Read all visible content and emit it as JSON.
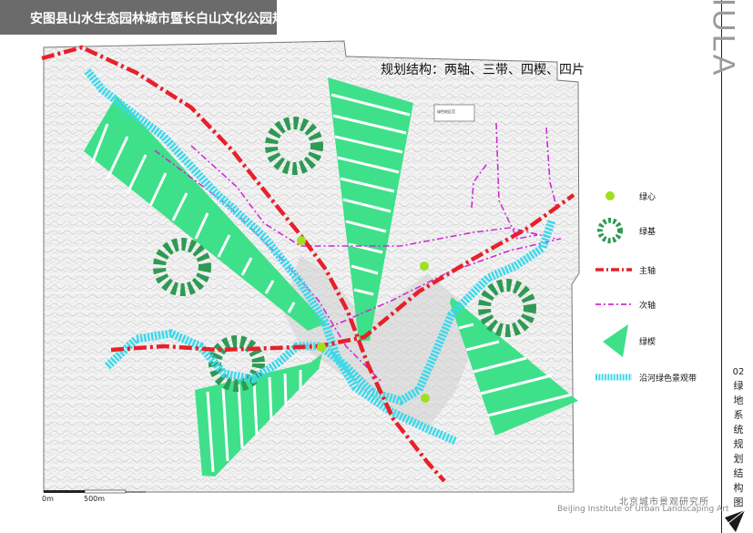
{
  "header": {
    "title": "安图县山水生态园林城市暨长白山文化公园规划"
  },
  "brand": {
    "logo_text": "IULA",
    "institute_cn": "北京城市景观研究所",
    "institute_en": "BeiJing Institute of Urban Landscaping Art"
  },
  "sheet": {
    "number": "02",
    "title_chars": [
      "绿",
      "地",
      "系",
      "统",
      "规",
      "划",
      "结",
      "构",
      "图"
    ]
  },
  "map": {
    "heading": "规划结构：两轴、三带、四楔、四片",
    "scale": {
      "start_label": "0m",
      "end_label": "500m"
    },
    "base_map_text": "绿色地区范"
  },
  "legend": {
    "items": [
      {
        "key": "green_core",
        "label": "绿心",
        "symbol": "yellow-green-dot"
      },
      {
        "key": "green_base",
        "label": "绿基",
        "symbol": "dashed-ring"
      },
      {
        "key": "main_axis",
        "label": "主轴",
        "symbol": "red-dash-dot-line"
      },
      {
        "key": "secondary_axis",
        "label": "次轴",
        "symbol": "magenta-dash-dot-line"
      },
      {
        "key": "green_wedge",
        "label": "绿楔",
        "symbol": "green-wedge"
      },
      {
        "key": "river_belt",
        "label": "沿河绿色景观带",
        "symbol": "cyan-hatched-band"
      }
    ]
  },
  "colors": {
    "wedge_green": "#3fe08a",
    "ring_green": "#2e9a53",
    "main_axis_red": "#e8202a",
    "secondary_axis_magenta": "#d02ad6",
    "river_cyan": "#3ed8ea",
    "core_dot": "#9fe01f",
    "title_bar": "#6b6b6b"
  }
}
